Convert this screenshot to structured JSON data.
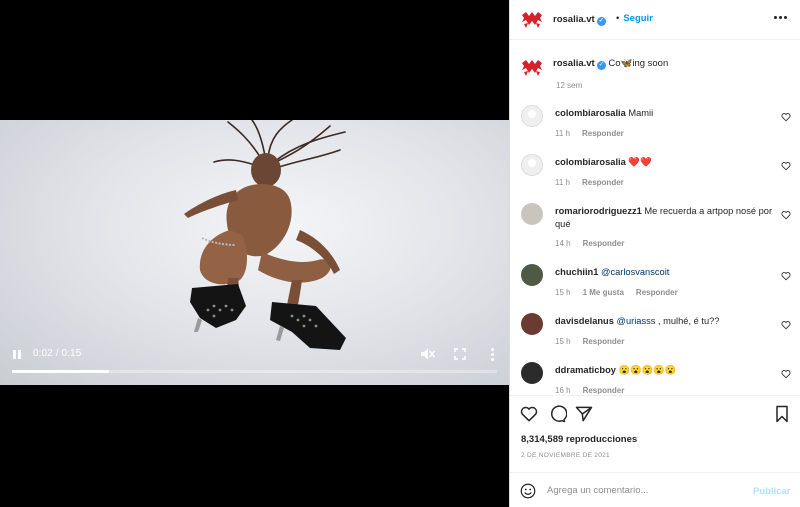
{
  "video": {
    "time_current": "0:02",
    "time_total": "0:15",
    "time_label": "0:02 / 0:15",
    "progress_fraction": 0.2,
    "muted": true
  },
  "header": {
    "username": "rosalia.vt",
    "verified": true,
    "separator": "•",
    "follow_label": "Seguir"
  },
  "caption": {
    "username": "rosalia.vt",
    "text": "Co🦋ing soon",
    "age": "12 sem"
  },
  "reply_label": "Responder",
  "comments": [
    {
      "username": "colombiarosalia",
      "text": "Mamii",
      "age": "11 h",
      "likes": ""
    },
    {
      "username": "colombiarosalia",
      "text": "❤️❤️",
      "age": "11 h",
      "likes": ""
    },
    {
      "username": "romariorodriguezz1",
      "text": "Me recuerda a artpop nosé por qué",
      "age": "14 h",
      "likes": ""
    },
    {
      "username": "chuchiin1",
      "text": "@carlosvanscoit",
      "age": "15 h",
      "likes": "1 Me gusta"
    },
    {
      "username": "davisdelanus",
      "mention": "@uriasss",
      "text": " , mulhé, é tu??",
      "age": "15 h",
      "likes": ""
    },
    {
      "username": "ddramaticboy",
      "text": "😮😮😮😮😮",
      "age": "16 h",
      "likes": ""
    }
  ],
  "stats": {
    "views": "8,314,589 reproducciones",
    "date": "2 DE NOVIEMBRE DE 2021"
  },
  "comment_box": {
    "placeholder": "Agrega un comentario...",
    "publish_label": "Publicar"
  },
  "colors": {
    "accent": "#0095f6",
    "verified": "#3897f0",
    "logo_red": "#d6202a",
    "muted_text": "#8e8e8e"
  }
}
